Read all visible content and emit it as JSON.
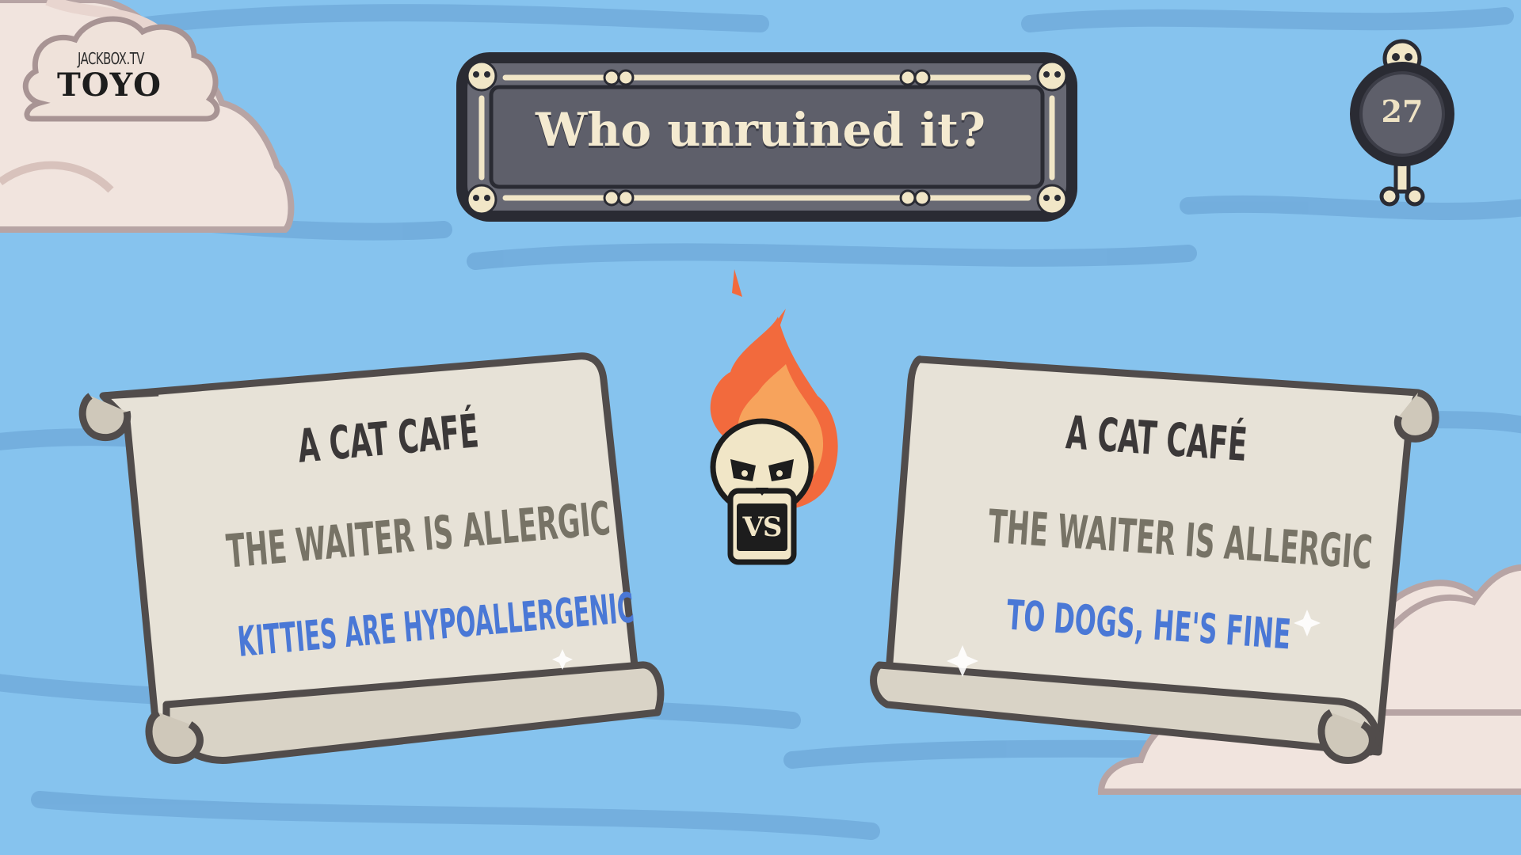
{
  "logo": {
    "small": "JACKBOX.TV",
    "big": "TOYO"
  },
  "prompt": {
    "title": "Who unruined it?"
  },
  "timer": {
    "value": "27"
  },
  "versus": {
    "label": "VS"
  },
  "answers": [
    {
      "setup": "A CAT CAFÉ",
      "twist": "THE WAITER IS ALLERGIC",
      "answer": "KITTIES ARE HYPOALLERGENIC"
    },
    {
      "setup": "A CAT CAFÉ",
      "twist": "THE WAITER IS ALLERGIC",
      "answer": "TO DOGS, HE'S FINE"
    }
  ],
  "colors": {
    "background": "#86c3ee",
    "frame": "#5a5b66",
    "frame_border": "#2a2b33",
    "parchment": "#e7e2d7",
    "answer_blue": "#4a78d6",
    "flame": "#f26a3d"
  }
}
